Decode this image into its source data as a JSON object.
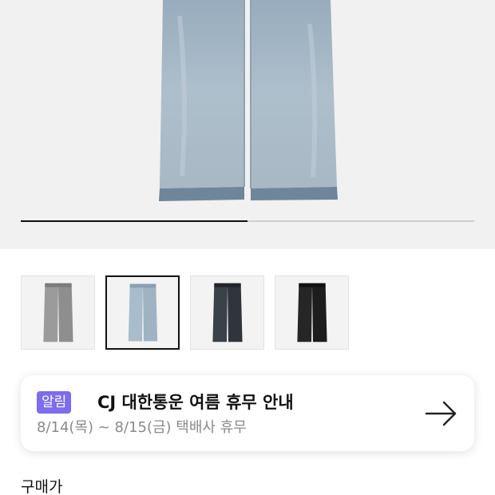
{
  "gallery": {
    "progress": 0.5,
    "thumbnails": [
      {
        "name": "grey-wash",
        "color": "#9a9a9a"
      },
      {
        "name": "light-blue-wash",
        "color": "#a9bccb",
        "selected": true
      },
      {
        "name": "dark-wash",
        "color": "#353a40"
      },
      {
        "name": "black-wash",
        "color": "#222222"
      }
    ]
  },
  "notice": {
    "badge": "알림",
    "title": "CJ 대한통운 여름 휴무 안내",
    "subtitle": "8/14(목) ~ 8/15(금) 택배사 휴무",
    "icon": "arrow-right-icon"
  },
  "purchase": {
    "price_label": "구매가"
  },
  "colors": {
    "accent": "#7b6cf0",
    "hero_bg": "#f1f1f1"
  }
}
